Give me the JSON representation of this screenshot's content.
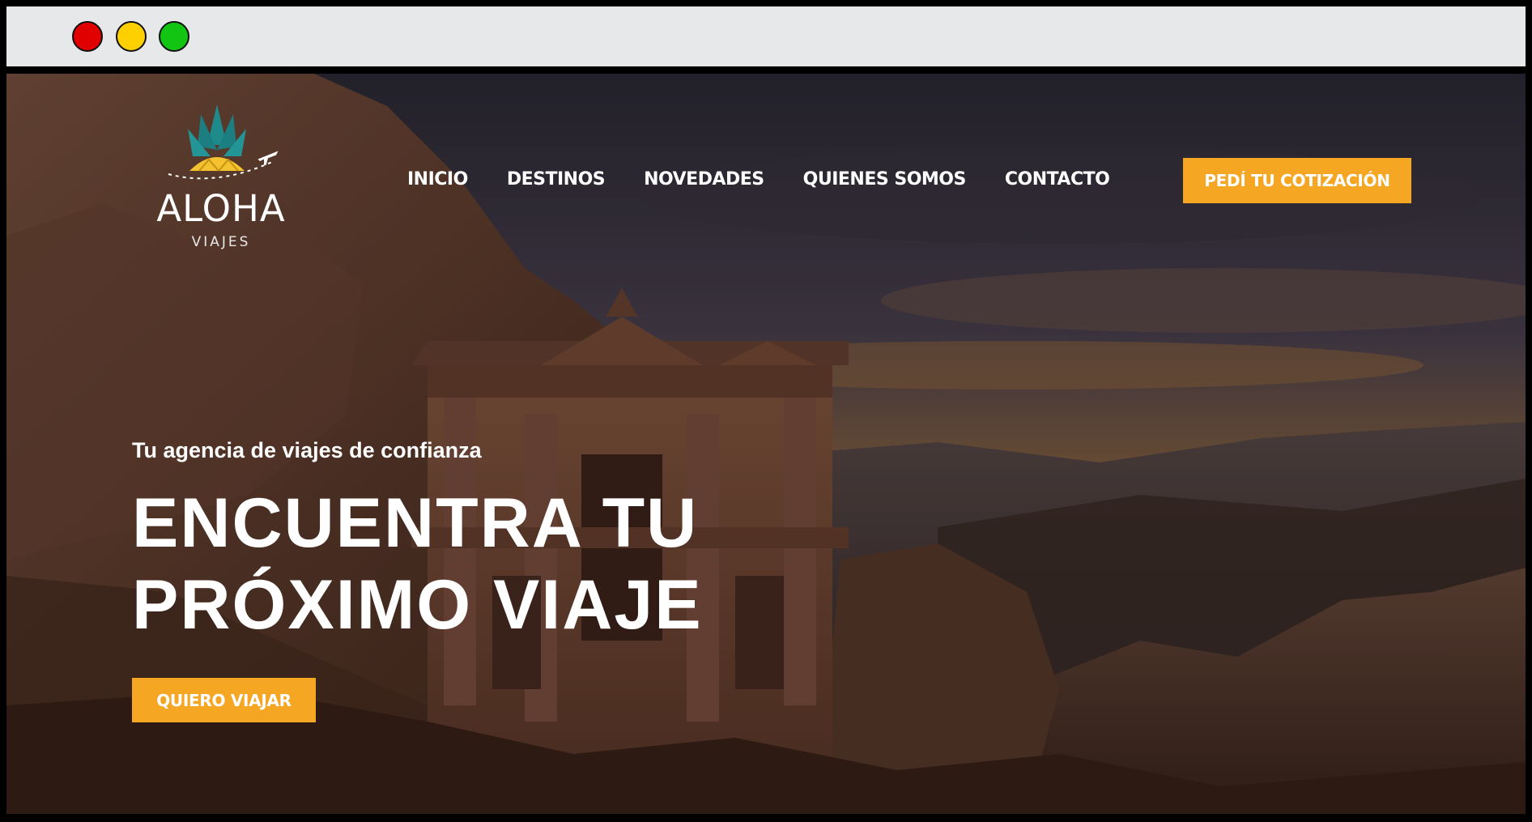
{
  "window": {
    "controls": [
      "close",
      "minimize",
      "maximize"
    ]
  },
  "brand": {
    "name": "ALOHA",
    "subtitle": "VIAJES"
  },
  "nav": {
    "items": [
      {
        "label": "INICIO"
      },
      {
        "label": "DESTINOS"
      },
      {
        "label": "NOVEDADES"
      },
      {
        "label": "QUIENES SOMOS"
      },
      {
        "label": "CONTACTO"
      }
    ],
    "cta_label": "PEDÍ TU COTIZACIÓN"
  },
  "hero": {
    "tagline": "Tu agencia de viajes de confianza",
    "headline_line1": "ENCUENTRA TU",
    "headline_line2": "PRÓXIMO VIAJE",
    "cta_label": "QUIERO VIAJAR"
  },
  "colors": {
    "accent": "#f5a623",
    "titlebar": "#e7e8ea",
    "logo_leaf": "#1f8a8c",
    "logo_fruit": "#f2c230"
  },
  "icons": {
    "airplane": "airplane-icon",
    "pineapple": "pineapple-logo-icon"
  }
}
